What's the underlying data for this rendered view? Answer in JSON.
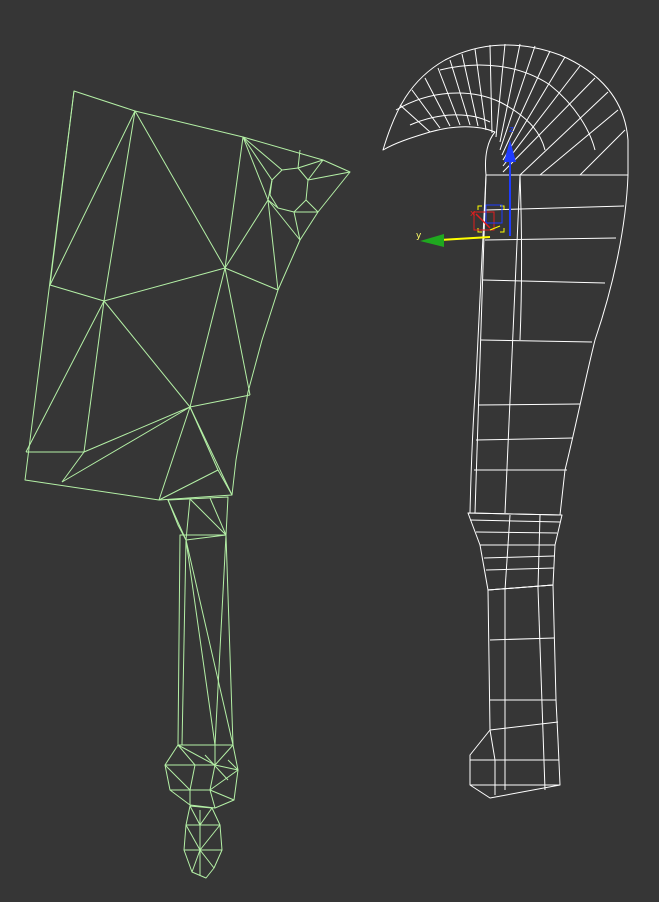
{
  "viewport": {
    "background": "#363636"
  },
  "cleaver": {
    "fill": "#7a7a7a",
    "wire_color": "#b4f0a6"
  },
  "sickle": {
    "fill": "#52c7ad",
    "wire_color": "#ffffff"
  },
  "gizmo": {
    "axis_z_label": "z",
    "axis_y_label": "y",
    "axis_x_label": "x",
    "axis_z_color": "#1f3cff",
    "axis_y_color": "#1fa81f",
    "axis_x_color": "#e01f1f",
    "selection_color": "#ffff00"
  }
}
